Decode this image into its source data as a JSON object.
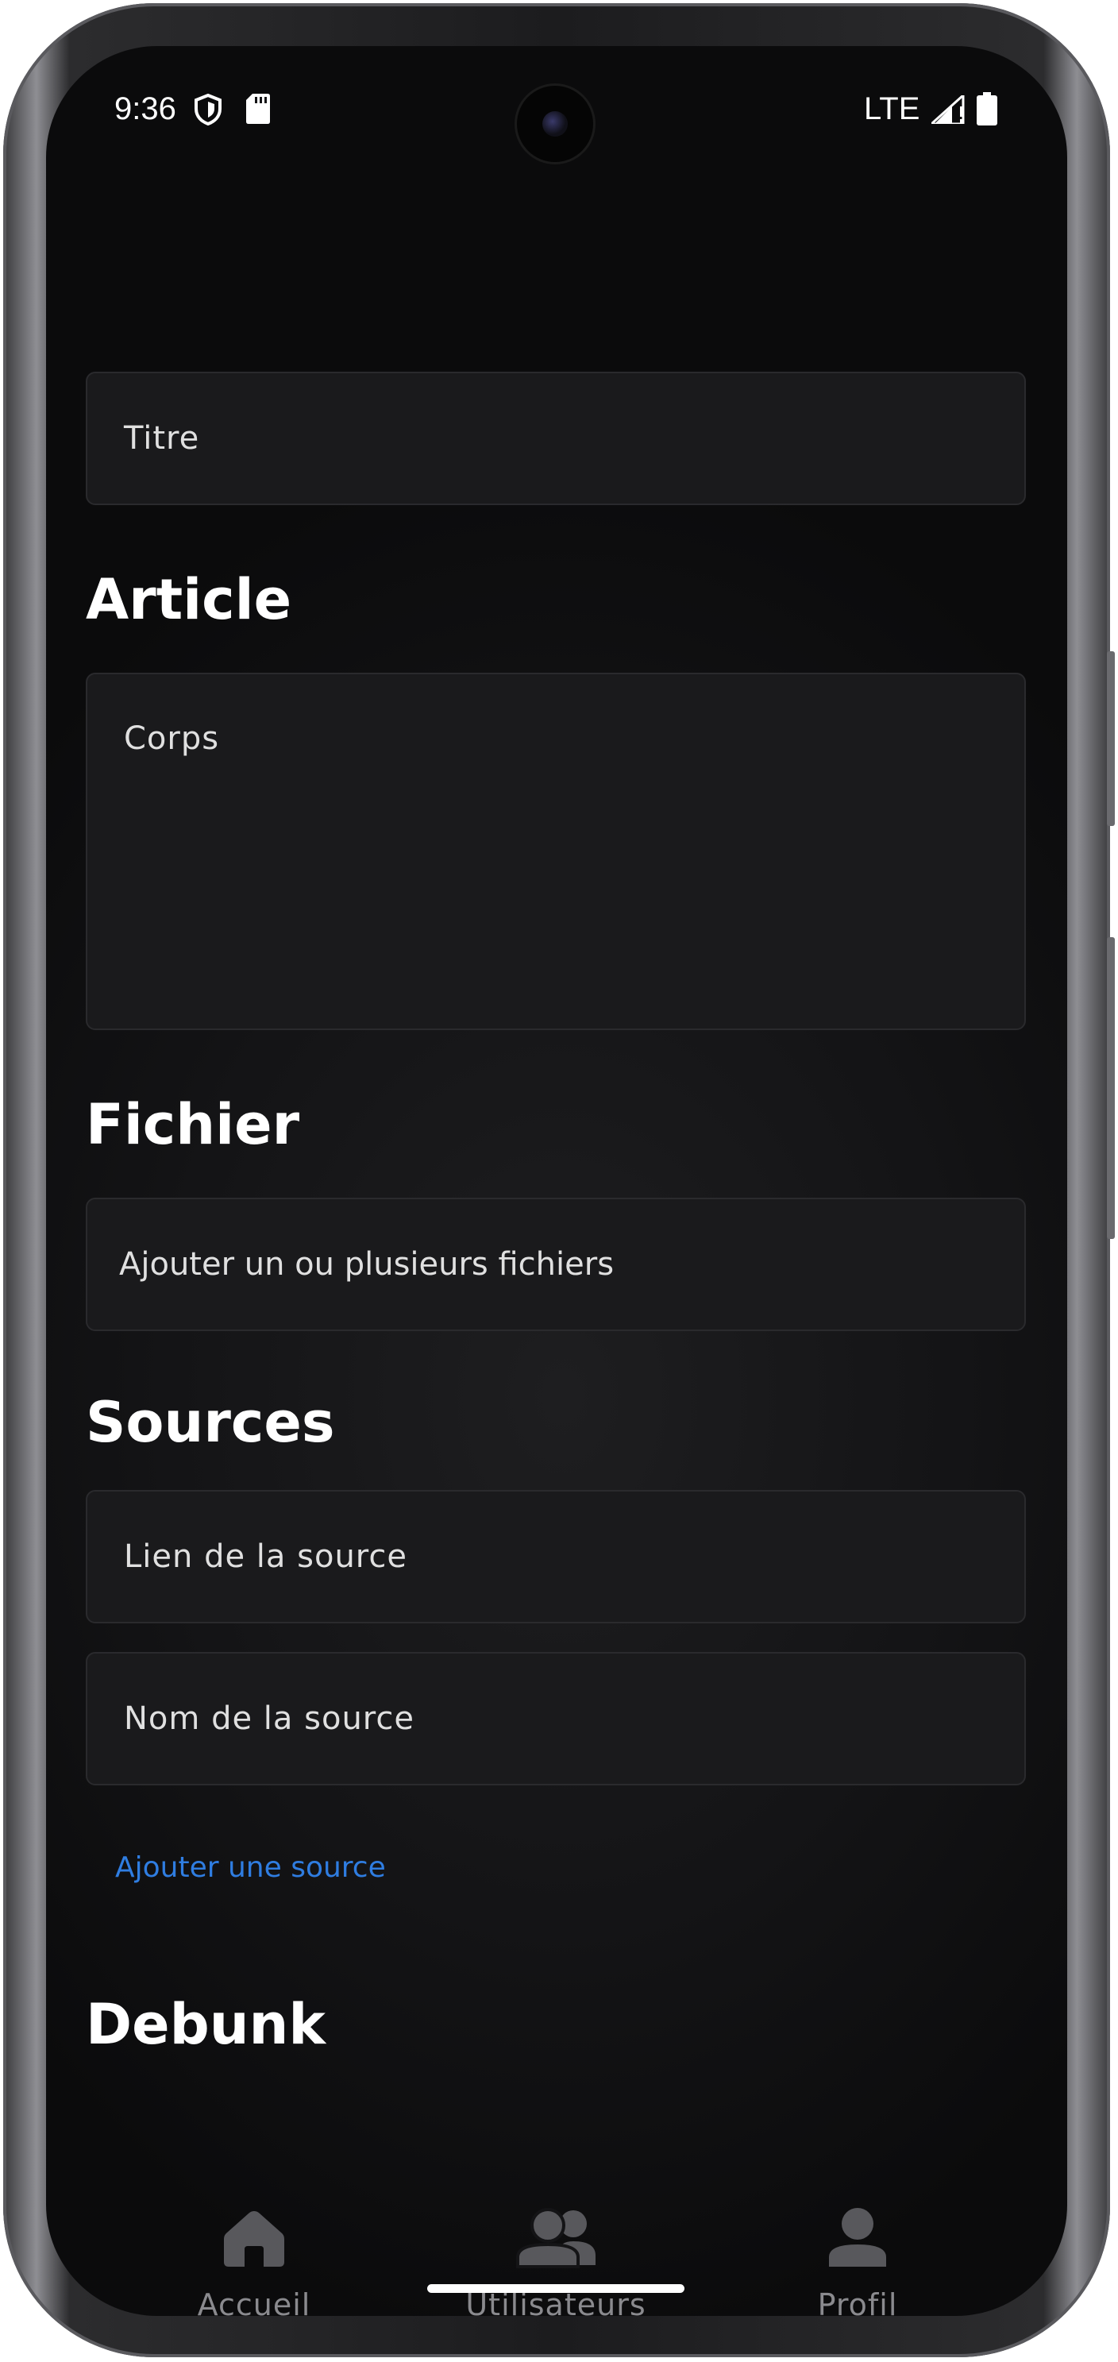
{
  "status_bar": {
    "time": "9:36",
    "network": "LTE",
    "icons": [
      "shield-icon",
      "sd-card-icon",
      "signal-icon",
      "battery-icon"
    ]
  },
  "form": {
    "title_placeholder": "Titre",
    "article_heading": "Article",
    "body_placeholder": "Corps",
    "file_heading": "Fichier",
    "file_button_label": "Ajouter un ou plusieurs fichiers",
    "sources_heading": "Sources",
    "source_link_placeholder": "Lien de la source",
    "source_name_placeholder": "Nom de la source",
    "add_source_label": "Ajouter une source",
    "debunk_heading": "Debunk"
  },
  "nav": {
    "items": [
      {
        "label": "Accueil",
        "icon": "home-icon"
      },
      {
        "label": "Utilisateurs",
        "icon": "users-icon"
      },
      {
        "label": "Profil",
        "icon": "profile-icon"
      }
    ]
  },
  "colors": {
    "background": "#141416",
    "field_background": "#1a1a1c",
    "link": "#2f7de1",
    "nav_inactive": "#8a8a8e"
  }
}
